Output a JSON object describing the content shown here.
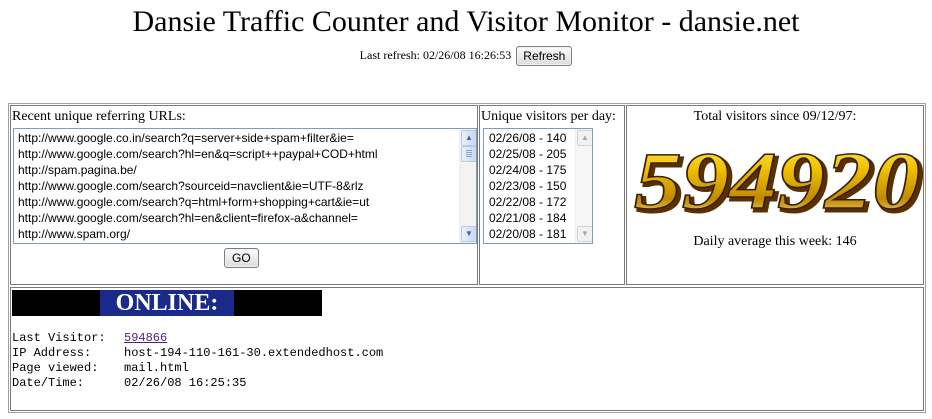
{
  "page": {
    "title": "Dansie Traffic Counter and Visitor Monitor - dansie.net",
    "refresh_label": "Last refresh: 02/26/08 16:26:53",
    "refresh_button": "Refresh"
  },
  "referrers": {
    "caption": "Recent unique referring URLs:",
    "urls": [
      "http://www.google.co.in/search?q=server+side+spam+filter&ie=",
      "http://www.google.com/search?hl=en&q=script++paypal+COD+html",
      "http://spam.pagina.be/",
      "http://www.google.com/search?sourceid=navclient&ie=UTF-8&rlz",
      "http://www.google.com/search?q=html+form+shopping+cart&ie=ut",
      "http://www.google.com/search?hl=en&client=firefox-a&channel=",
      "http://www.spam.org/"
    ],
    "go_button": "GO"
  },
  "daily": {
    "caption": "Unique visitors per day:",
    "entries": [
      "02/26/08 - 140",
      "02/25/08 - 205",
      "02/24/08 - 175",
      "02/23/08 - 150",
      "02/22/08 - 172",
      "02/21/08 - 184",
      "02/20/08 - 181"
    ]
  },
  "total": {
    "caption": "Total visitors since 09/12/97:",
    "count": "594920",
    "daily_average": "Daily average this week: 146"
  },
  "online": {
    "banner": "ONLINE:",
    "last_visitor_label": "Last Visitor:",
    "last_visitor_value": "594866",
    "ip_label": "IP Address:",
    "ip_value": "host-194-110-161-30.extendedhost.com",
    "page_label": "Page viewed:",
    "page_value": "mail.html",
    "date_label": "Date/Time:",
    "date_value": "02/26/08 16:25:35"
  },
  "colors": {
    "digit_gold": "#f2c400",
    "digit_shadow": "#6b3a00",
    "online_bg": "#1a2a8a",
    "link": "#551a8b"
  },
  "icons": {
    "scroll_up": "scroll-up-arrow-icon",
    "scroll_down": "scroll-down-arrow-icon"
  }
}
